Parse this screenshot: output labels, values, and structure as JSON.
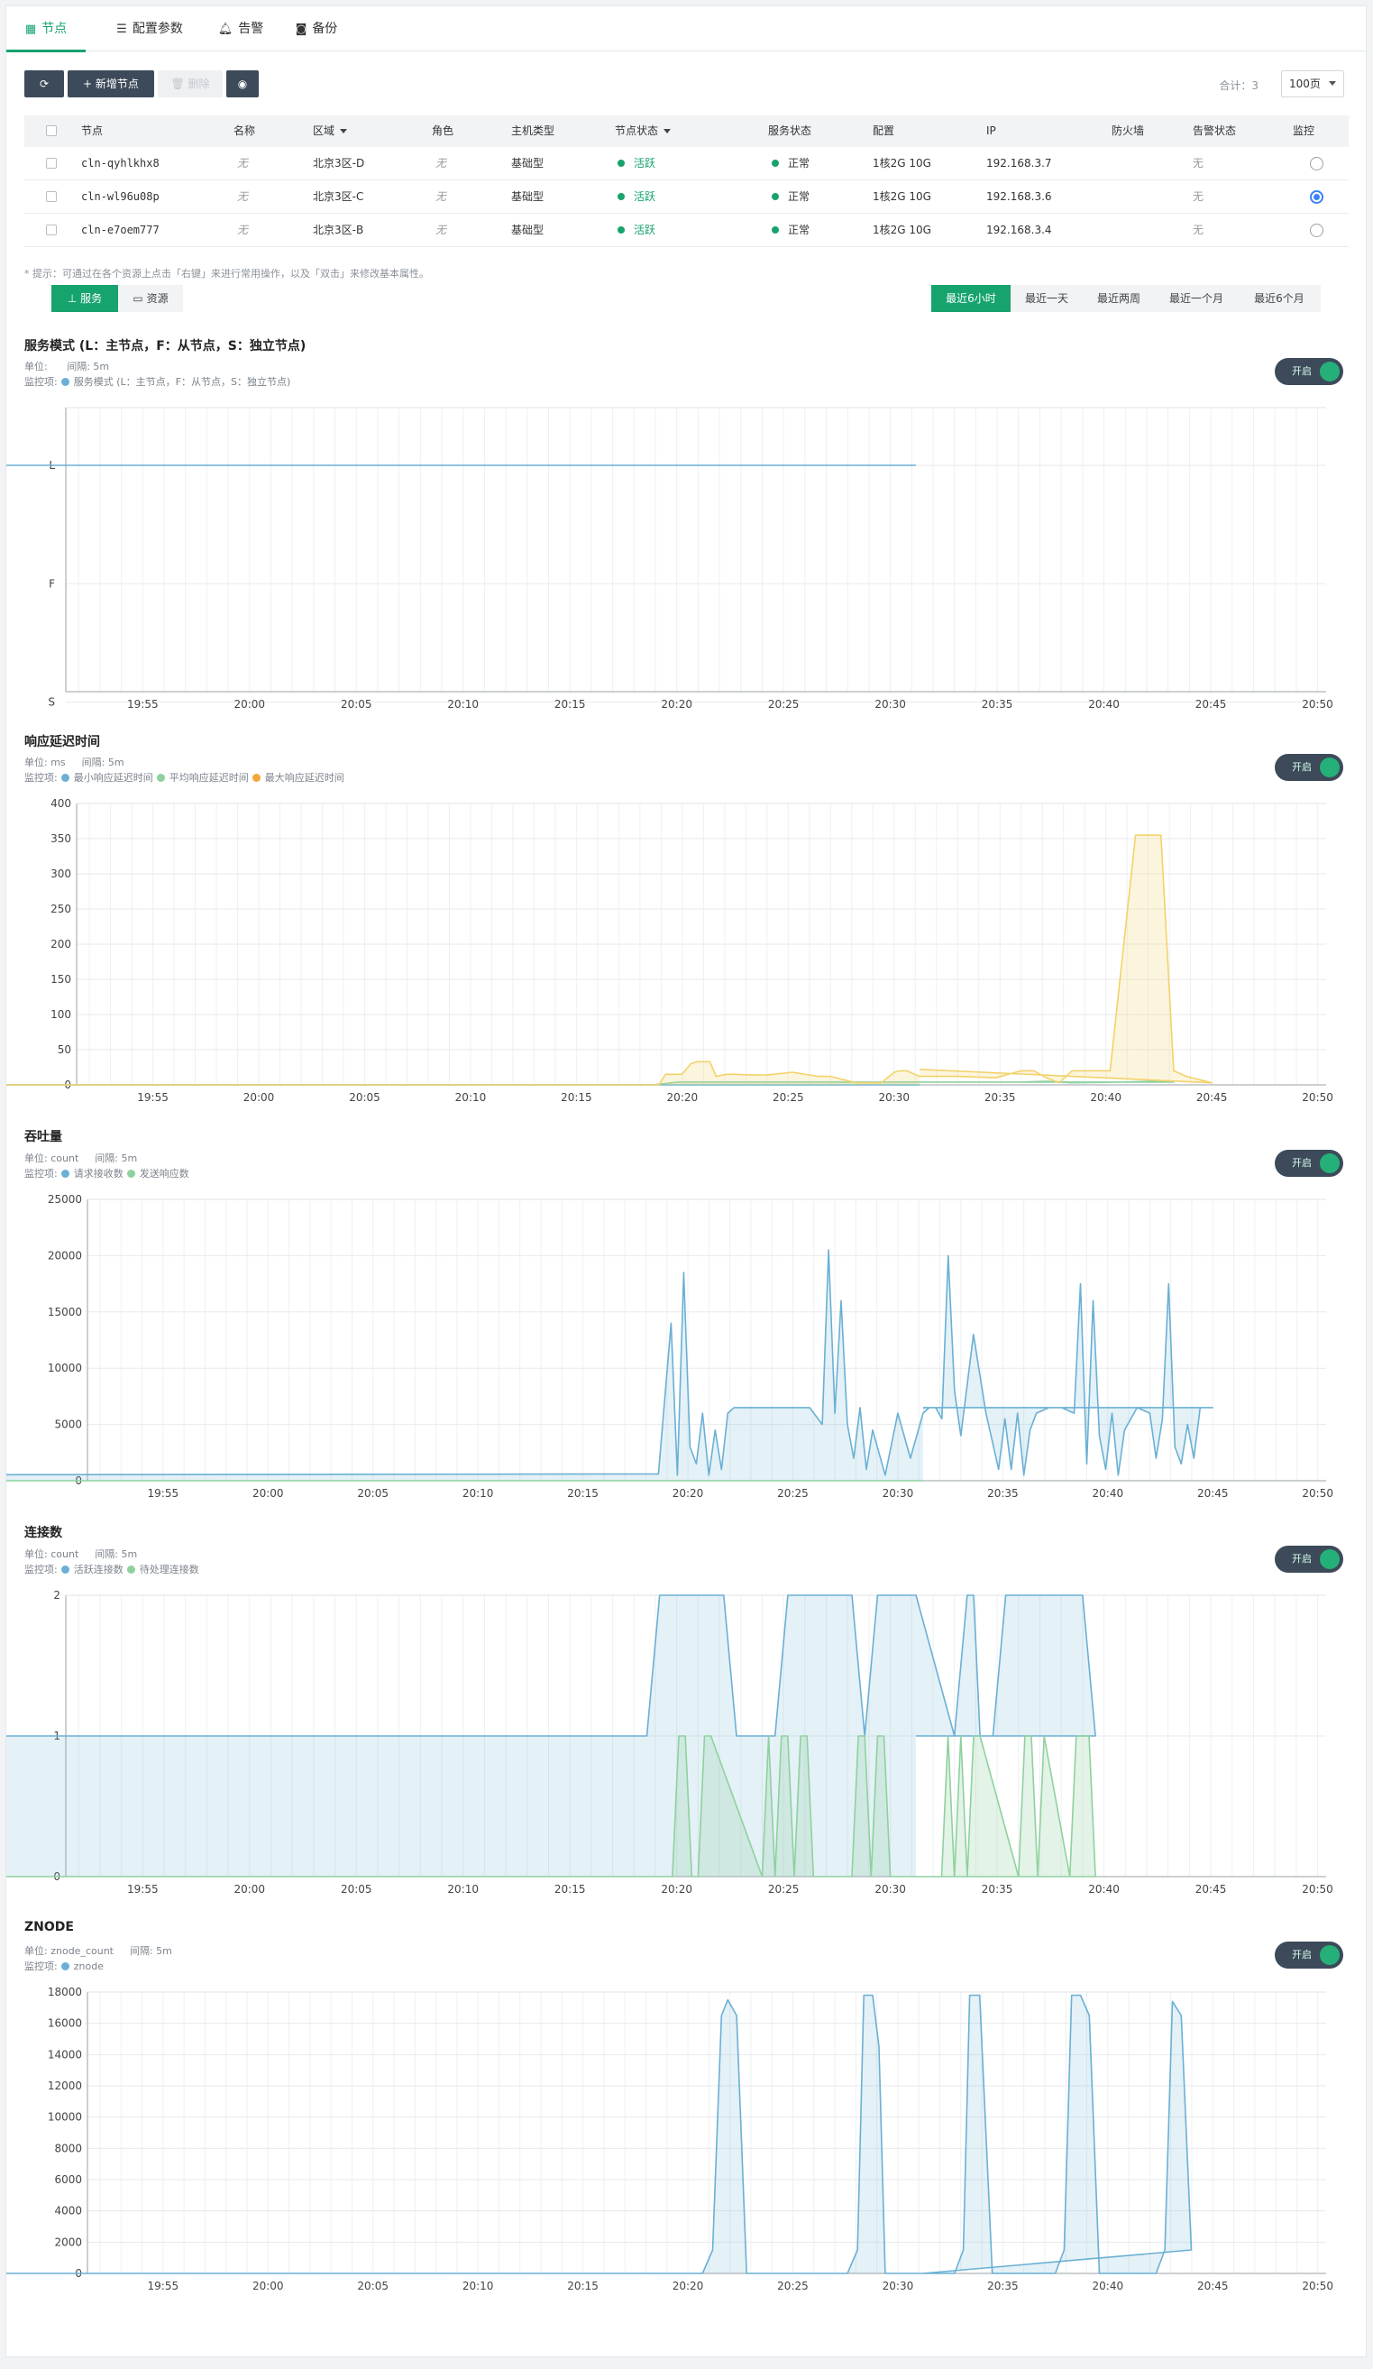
{
  "tabs": [
    {
      "label": "节点",
      "icon": "grid-icon"
    },
    {
      "label": "配置参数",
      "icon": "list-icon"
    },
    {
      "label": "告警",
      "icon": "bell-icon"
    },
    {
      "label": "备份",
      "icon": "camera-icon"
    }
  ],
  "toolbar": {
    "refresh_icon": "refresh-icon",
    "add_label": "新增节点",
    "delete_label": "删除",
    "eye_icon": "eye-icon",
    "total": "合计：3",
    "page_size": "100页"
  },
  "table": {
    "headers": [
      "节点",
      "名称",
      "区域",
      "角色",
      "主机类型",
      "节点状态",
      "服务状态",
      "配置",
      "IP",
      "防火墙",
      "告警状态",
      "监控"
    ],
    "rows": [
      {
        "node": "cln-qyhlkhx8",
        "name": "无",
        "zone": "北京3区-D",
        "role": "无",
        "host_type": "基础型",
        "node_status": "活跃",
        "service_status": "正常",
        "config": "1核2G 10G",
        "ip": "192.168.3.7",
        "firewall": "",
        "alarm": "无",
        "monitor": false
      },
      {
        "node": "cln-wl96u08p",
        "name": "无",
        "zone": "北京3区-C",
        "role": "无",
        "host_type": "基础型",
        "node_status": "活跃",
        "service_status": "正常",
        "config": "1核2G 10G",
        "ip": "192.168.3.6",
        "firewall": "",
        "alarm": "无",
        "monitor": true
      },
      {
        "node": "cln-e7oem777",
        "name": "无",
        "zone": "北京3区-B",
        "role": "无",
        "host_type": "基础型",
        "node_status": "活跃",
        "service_status": "正常",
        "config": "1核2G 10G",
        "ip": "192.168.3.4",
        "firewall": "",
        "alarm": "无",
        "monitor": false
      }
    ]
  },
  "hint": "* 提示：可通过在各个资源上点击「右键」来进行常用操作，以及「双击」来修改基本属性。",
  "view_tabs": [
    {
      "label": "服务",
      "icon": "sitemap-icon",
      "active": true
    },
    {
      "label": "资源",
      "icon": "monitor-icon",
      "active": false
    }
  ],
  "time_ranges": [
    {
      "label": "最近6小时",
      "active": true
    },
    {
      "label": "最近一天",
      "active": false
    },
    {
      "label": "最近两周",
      "active": false
    },
    {
      "label": "最近一个月",
      "active": false
    },
    {
      "label": "最近6个月",
      "active": false
    }
  ],
  "toggle_label": "开启",
  "unit_prefix": "单位:",
  "interval_label": "间隔: 5m",
  "legend_prefix": "监控项:",
  "colors": {
    "blue": "#6ab0d4",
    "green": "#8fd19e",
    "yellow": "#f3d26a",
    "accent": "#16a36e"
  },
  "chart_data": [
    {
      "title": "服务模式 (L：主节点，F：从节点，S：独立节点)",
      "unit": "",
      "type": "line",
      "categories": [
        "L",
        "F",
        "S"
      ],
      "x": [
        "19:55",
        "20:00",
        "20:05",
        "20:10",
        "20:15",
        "20:20",
        "20:25",
        "20:30",
        "20:35",
        "20:40",
        "20:45",
        "20:50"
      ],
      "series": [
        {
          "name": "服务模式 (L：主节点，F：从节点，S：独立节点)",
          "color": "#6ab0d4",
          "t": [
            19.52,
            20.52
          ],
          "v": [
            2,
            2
          ]
        }
      ]
    },
    {
      "title": "响应延迟时间",
      "unit": "ms",
      "type": "area",
      "ylim": [
        0,
        400
      ],
      "yticks": [
        0,
        50,
        100,
        150,
        200,
        250,
        300,
        350,
        400
      ],
      "x": [
        "19:55",
        "20:00",
        "20:05",
        "20:10",
        "20:15",
        "20:20",
        "20:25",
        "20:30",
        "20:35",
        "20:40",
        "20:45",
        "20:50"
      ],
      "series": [
        {
          "name": "最小响应延迟时间",
          "color": "#6ab0d4",
          "t": [
            19.52,
            20.52
          ],
          "v": [
            0,
            0
          ]
        },
        {
          "name": "平均响应延迟时间",
          "color": "#8fd19e",
          "t": [
            19.52,
            20.31,
            20.33,
            20.6,
            20.62,
            20.64,
            20.68,
            20.7,
            20.72,
            20.52
          ],
          "v": [
            0,
            0,
            4,
            4,
            5,
            3,
            4,
            5,
            4,
            4
          ]
        },
        {
          "name": "最大响应延迟时间",
          "color": "#f3d26a",
          "t": [
            19.52,
            20.315,
            20.32,
            20.333,
            20.34,
            20.345,
            20.355,
            20.36,
            20.368,
            20.375,
            20.39,
            20.4,
            20.42,
            20.44,
            20.45,
            20.47,
            20.49,
            20.5,
            20.505,
            20.51,
            20.52,
            20.528,
            20.55,
            20.58,
            20.6,
            20.61,
            20.62,
            20.63,
            20.64,
            20.67,
            20.69,
            20.71,
            20.72,
            20.73,
            20.75,
            20.52
          ],
          "v": [
            0,
            0,
            15,
            15,
            30,
            33,
            33,
            12,
            15,
            15,
            14,
            14,
            18,
            12,
            12,
            3,
            3,
            18,
            20,
            20,
            12,
            12,
            12,
            10,
            20,
            20,
            10,
            3,
            20,
            20,
            355,
            355,
            20,
            12,
            3,
            22
          ]
        }
      ]
    },
    {
      "title": "吞吐量",
      "unit": "count",
      "type": "area",
      "ylim": [
        0,
        25000
      ],
      "yticks": [
        0,
        5000,
        10000,
        15000,
        20000,
        25000
      ],
      "x": [
        "19:55",
        "20:00",
        "20:05",
        "20:10",
        "20:15",
        "20:20",
        "20:25",
        "20:30",
        "20:35",
        "20:40",
        "20:45",
        "20:50"
      ],
      "series": [
        {
          "name": "请求接收数",
          "color": "#6ab0d4",
          "t": [
            19.52,
            20.31,
            20.32,
            20.325,
            20.33,
            20.335,
            20.34,
            20.345,
            20.35,
            20.355,
            20.36,
            20.365,
            20.37,
            20.38,
            20.39,
            20.4,
            20.43,
            20.44,
            20.445,
            20.45,
            20.455,
            20.46,
            20.465,
            20.47,
            20.475,
            20.48,
            20.49,
            20.5,
            20.51,
            20.52,
            20.525,
            20.53,
            20.535,
            20.54,
            20.545,
            20.55,
            20.56,
            20.57,
            20.58,
            20.585,
            20.59,
            20.595,
            20.6,
            20.605,
            20.61,
            20.62,
            20.63,
            20.64,
            20.645,
            20.65,
            20.655,
            20.66,
            20.665,
            20.67,
            20.675,
            20.68,
            20.69,
            20.7,
            20.705,
            20.71,
            20.715,
            20.72,
            20.725,
            20.73,
            20.735,
            20.74,
            20.75,
            20.52
          ],
          "v": [
            500,
            600,
            14000,
            500,
            18500,
            3000,
            1500,
            6000,
            500,
            4500,
            1000,
            6000,
            6500,
            6500,
            6500,
            6500,
            6500,
            5000,
            20500,
            6000,
            16000,
            5000,
            2000,
            6500,
            1000,
            4500,
            500,
            6000,
            2000,
            6000,
            6500,
            6500,
            5500,
            20000,
            8000,
            4000,
            13000,
            6000,
            1000,
            5500,
            1000,
            6000,
            500,
            4500,
            6000,
            6500,
            6500,
            6000,
            17500,
            1500,
            16000,
            4000,
            1000,
            6000,
            500,
            4500,
            6500,
            6000,
            2000,
            5500,
            17500,
            3000,
            1500,
            5000,
            2000,
            6500,
            6500,
            6500
          ]
        },
        {
          "name": "发送响应数",
          "color": "#8fd19e",
          "t": [
            19.52,
            20.52
          ],
          "v": [
            0,
            0
          ]
        }
      ]
    },
    {
      "title": "连接数",
      "unit": "count",
      "type": "area",
      "ylim": [
        0,
        2
      ],
      "yticks": [
        0,
        1,
        2
      ],
      "x": [
        "19:55",
        "20:00",
        "20:05",
        "20:10",
        "20:15",
        "20:20",
        "20:25",
        "20:30",
        "20:35",
        "20:40",
        "20:45",
        "20:50"
      ],
      "series": [
        {
          "name": "活跃连接数",
          "color": "#6ab0d4",
          "t": [
            19.52,
            20.31,
            20.32,
            20.35,
            20.37,
            20.38,
            20.39,
            20.41,
            20.42,
            20.45,
            20.47,
            20.48,
            20.49,
            20.51,
            20.52,
            20.55,
            20.56,
            20.565,
            20.57,
            20.58,
            20.59,
            20.61,
            20.62,
            20.65,
            20.66,
            20.52
          ],
          "v": [
            1,
            1,
            2,
            2,
            2,
            1,
            1,
            1,
            2,
            2,
            2,
            1,
            2,
            2,
            2,
            1,
            2,
            2,
            1,
            1,
            2,
            2,
            2,
            2,
            1,
            1
          ]
        },
        {
          "name": "待处理连接数",
          "color": "#8fd19e",
          "t": [
            19.52,
            20.33,
            20.335,
            20.34,
            20.345,
            20.35,
            20.355,
            20.36,
            20.4,
            20.405,
            20.41,
            20.415,
            20.42,
            20.425,
            20.43,
            20.435,
            20.44,
            20.47,
            20.475,
            20.48,
            20.485,
            20.49,
            20.495,
            20.5,
            20.54,
            20.545,
            20.55,
            20.555,
            20.56,
            20.565,
            20.57,
            20.6,
            20.605,
            20.61,
            20.615,
            20.62,
            20.64,
            20.645,
            20.65,
            20.655,
            20.66,
            20.52
          ],
          "v": [
            0,
            0,
            1,
            1,
            0,
            0,
            1,
            1,
            0,
            1,
            0,
            1,
            1,
            0,
            1,
            1,
            0,
            0,
            1,
            1,
            0,
            1,
            1,
            0,
            0,
            1,
            0,
            1,
            0,
            1,
            1,
            0,
            1,
            1,
            0,
            1,
            0,
            1,
            1,
            1,
            0,
            0
          ]
        }
      ]
    },
    {
      "title": "ZNODE",
      "unit": "znode_count",
      "type": "area",
      "ylim": [
        0,
        18000
      ],
      "yticks": [
        0,
        2000,
        4000,
        6000,
        8000,
        10000,
        12000,
        14000,
        16000,
        18000
      ],
      "x": [
        "19:55",
        "20:00",
        "20:05",
        "20:10",
        "20:15",
        "20:20",
        "20:25",
        "20:30",
        "20:35",
        "20:40",
        "20:45",
        "20:50"
      ],
      "series": [
        {
          "name": "znode",
          "color": "#6ab0d4",
          "t": [
            19.52,
            20.345,
            20.353,
            20.36,
            20.365,
            20.372,
            20.38,
            20.46,
            20.468,
            20.473,
            20.48,
            20.485,
            20.49,
            20.545,
            20.552,
            20.557,
            20.565,
            20.575,
            20.625,
            20.632,
            20.638,
            20.645,
            20.652,
            20.66,
            20.705,
            20.712,
            20.718,
            20.725,
            20.733,
            20.52
          ],
          "v": [
            0,
            0,
            1500,
            16500,
            17500,
            16500,
            0,
            0,
            1500,
            17800,
            17800,
            14500,
            0,
            0,
            1500,
            17800,
            17800,
            0,
            0,
            1500,
            17800,
            17800,
            16500,
            0,
            0,
            1500,
            17400,
            16500,
            1500,
            0
          ]
        }
      ]
    }
  ]
}
